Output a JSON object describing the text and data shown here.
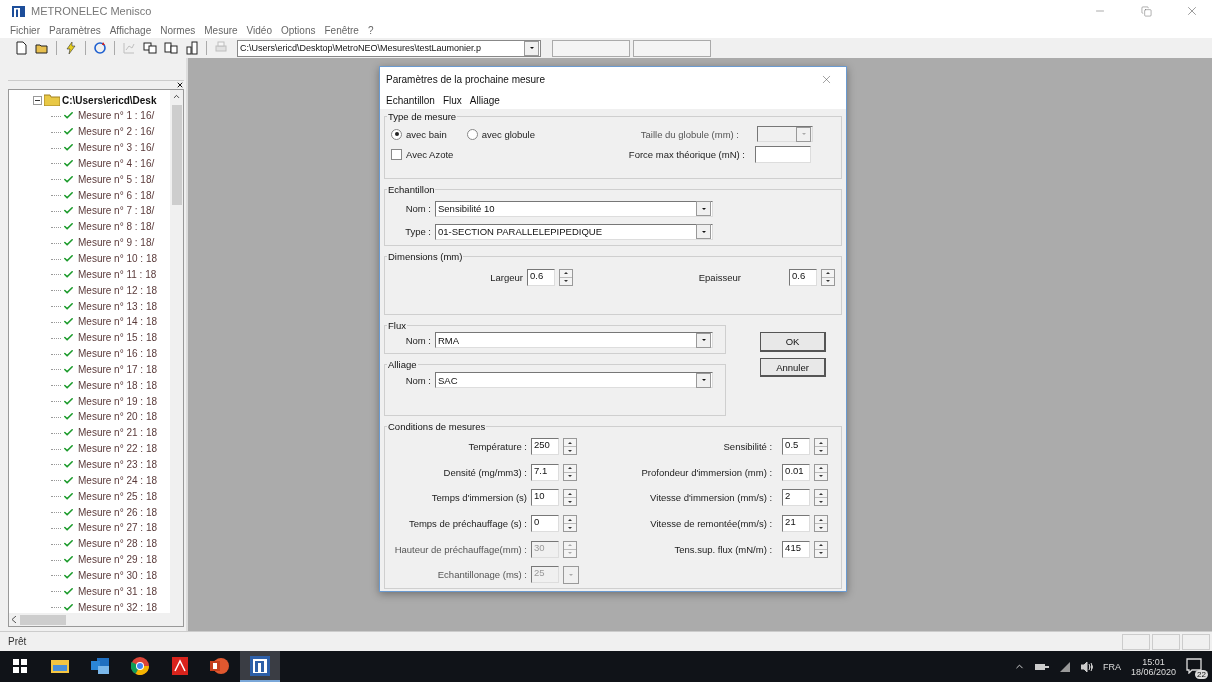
{
  "window": {
    "title": "METRONELEC Menisco"
  },
  "menu": [
    "Fichier",
    "Paramètres",
    "Affichage",
    "Normes",
    "Mesure",
    "Vidéo",
    "Options",
    "Fenêtre",
    "?"
  ],
  "toolbar": {
    "path": "C:\\Users\\ericd\\Desktop\\MetroNEO\\Mesures\\testLaumonier.p"
  },
  "tree": {
    "root": "C:\\Users\\ericd\\Desk",
    "expanded": true,
    "children": [
      {
        "label": "Mesure n° 1 : 16/"
      },
      {
        "label": "Mesure n° 2 : 16/"
      },
      {
        "label": "Mesure n° 3 : 16/"
      },
      {
        "label": "Mesure n° 4 : 16/"
      },
      {
        "label": "Mesure n° 5 : 18/"
      },
      {
        "label": "Mesure n° 6 : 18/"
      },
      {
        "label": "Mesure n° 7 : 18/"
      },
      {
        "label": "Mesure n° 8 : 18/"
      },
      {
        "label": "Mesure n° 9 : 18/"
      },
      {
        "label": "Mesure n° 10 : 18"
      },
      {
        "label": "Mesure n° 11 : 18"
      },
      {
        "label": "Mesure n° 12 : 18"
      },
      {
        "label": "Mesure n° 13 : 18"
      },
      {
        "label": "Mesure n° 14 : 18"
      },
      {
        "label": "Mesure n° 15 : 18"
      },
      {
        "label": "Mesure n° 16 : 18"
      },
      {
        "label": "Mesure n° 17 : 18"
      },
      {
        "label": "Mesure n° 18 : 18"
      },
      {
        "label": "Mesure n° 19 : 18"
      },
      {
        "label": "Mesure n° 20 : 18"
      },
      {
        "label": "Mesure n° 21 : 18"
      },
      {
        "label": "Mesure n° 22 : 18"
      },
      {
        "label": "Mesure n° 23 : 18"
      },
      {
        "label": "Mesure n° 24 : 18"
      },
      {
        "label": "Mesure n° 25 : 18"
      },
      {
        "label": "Mesure n° 26 : 18"
      },
      {
        "label": "Mesure n° 27 : 18"
      },
      {
        "label": "Mesure n° 28 : 18"
      },
      {
        "label": "Mesure n° 29 : 18"
      },
      {
        "label": "Mesure n° 30 : 18"
      },
      {
        "label": "Mesure n° 31 : 18"
      },
      {
        "label": "Mesure n° 32 : 18"
      }
    ]
  },
  "dialog": {
    "title": "Paramètres de la prochaine mesure",
    "menu": [
      "Echantillon",
      "Flux",
      "Alliage"
    ],
    "type_de_mesure": {
      "legend": "Type de mesure",
      "options": [
        {
          "label": "avec bain",
          "selected": true
        },
        {
          "label": "avec globule",
          "selected": false
        }
      ],
      "azote": {
        "label": "Avec Azote",
        "checked": false
      },
      "taille_globule": {
        "label": "Taille du globule (mm) :",
        "disabled": true
      },
      "force_max": {
        "label": "Force max théorique (mN) :"
      }
    },
    "echantillon": {
      "legend": "Echantillon",
      "fields": [
        {
          "label": "Nom :",
          "value": "Sensibilité 10"
        },
        {
          "label": "Type :",
          "value": "01-SECTION PARALLELEPIPEDIQUE"
        }
      ]
    },
    "dimensions": {
      "legend": "Dimensions (mm)",
      "fields": [
        {
          "label": "Largeur",
          "value": "0.6"
        },
        {
          "label": "Epaisseur",
          "value": "0.6"
        }
      ]
    },
    "flux": {
      "legend": "Flux",
      "field": {
        "label": "Nom :",
        "value": "RMA"
      }
    },
    "alliage": {
      "legend": "Alliage",
      "field": {
        "label": "Nom :",
        "value": "SAC"
      }
    },
    "buttons": [
      "OK",
      "Annuler"
    ],
    "conditions": {
      "legend": "Conditions de mesures",
      "left": [
        {
          "kind": "spin",
          "label": "Température :",
          "value": "250",
          "disabled": false
        },
        {
          "kind": "spin",
          "label": "Densité (mg/mm3) :",
          "value": "7.1",
          "disabled": false
        },
        {
          "kind": "spin",
          "label": "Temps d'immersion (s)",
          "value": "10",
          "disabled": false
        },
        {
          "kind": "spin",
          "label": "Temps de préchauffage (s) :",
          "value": "0",
          "disabled": false
        },
        {
          "kind": "spin",
          "label": "Hauteur de préchauffage(mm) :",
          "value": "30",
          "disabled": true
        },
        {
          "kind": "combo",
          "label": "Echantillonage (ms) :",
          "value": "25",
          "disabled": true
        }
      ],
      "right": [
        {
          "kind": "spin",
          "label": "Sensibilité :",
          "value": "0.5",
          "disabled": false
        },
        {
          "kind": "spin",
          "label": "Profondeur d'immersion  (mm) :",
          "value": "0.01",
          "disabled": false
        },
        {
          "kind": "spin",
          "label": "Vitesse d'immersion  (mm/s) :",
          "value": "2",
          "disabled": false
        },
        {
          "kind": "spin",
          "label": "Vitesse de remontée(mm/s) :",
          "value": "21",
          "disabled": false
        },
        {
          "kind": "spin",
          "label": "Tens.sup. flux (mN/m) :",
          "value": "415",
          "disabled": false
        }
      ]
    }
  },
  "status_bar": "Prêt",
  "taskbar": {
    "apps": [
      {
        "kind": "start",
        "selected": false
      },
      {
        "kind": "folder",
        "selected": false
      },
      {
        "kind": "mail",
        "selected": false
      },
      {
        "kind": "browser",
        "selected": false
      },
      {
        "kind": "pdf",
        "selected": false
      },
      {
        "kind": "slides",
        "selected": false
      },
      {
        "kind": "app",
        "selected": true
      }
    ],
    "language": "FRA",
    "time": "15:01",
    "date": "18/06/2020",
    "notifications": "22"
  }
}
